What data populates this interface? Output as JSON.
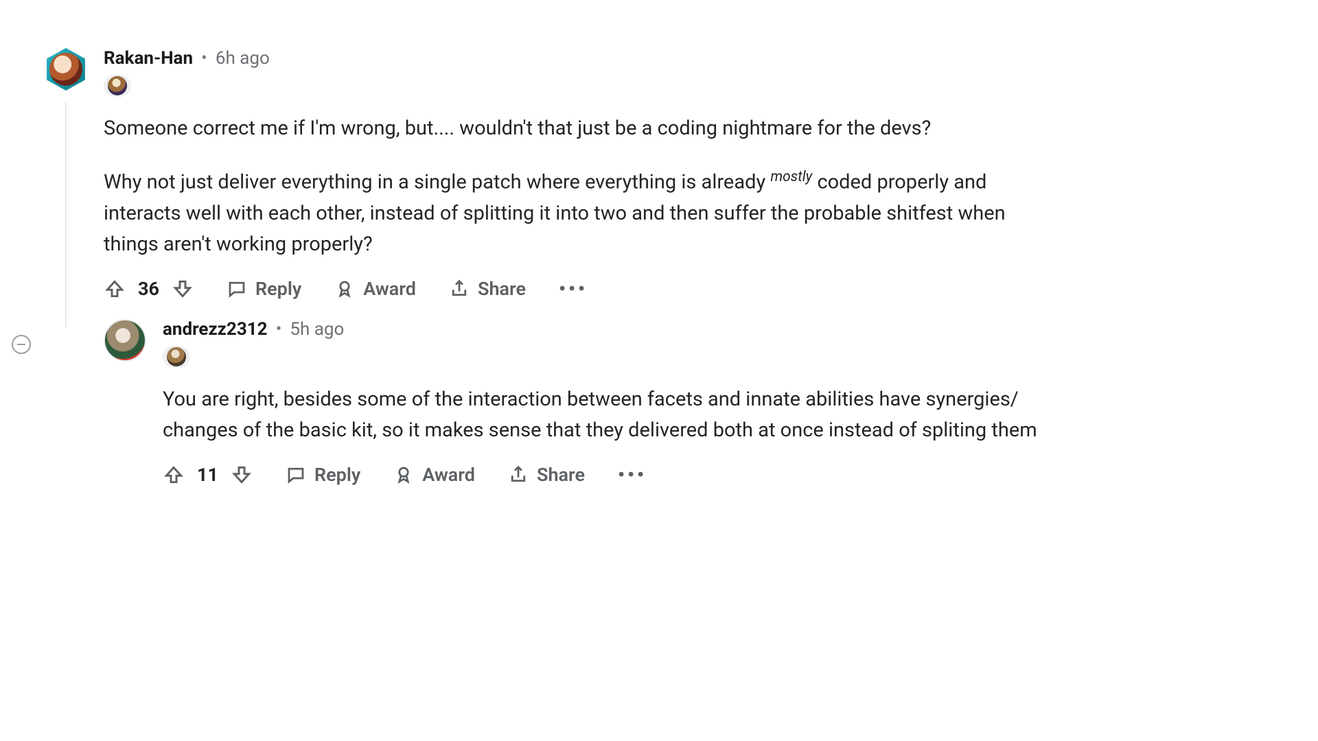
{
  "actions": {
    "reply": "Reply",
    "award": "Award",
    "share": "Share"
  },
  "comments": [
    {
      "username": "Rakan-Han",
      "time": "6h ago",
      "score": "36",
      "body_p1": "Someone correct me if I'm wrong, but.... wouldn't that just be a coding nightmare for the devs?",
      "body_p2_a": "Why not just deliver everything in a single patch where everything is already ",
      "body_p2_sup": "mostly",
      "body_p2_b": " coded properly and interacts well with each other, instead of splitting it into two and then suffer the probable shitfest when things aren't working properly?"
    },
    {
      "username": "andrezz2312",
      "time": "5h ago",
      "score": "11",
      "body_p1": "You are right, besides some of the interaction between facets and innate abilities have synergies/ changes of the basic kit, so it makes sense that they delivered both at once instead of spliting them"
    }
  ]
}
